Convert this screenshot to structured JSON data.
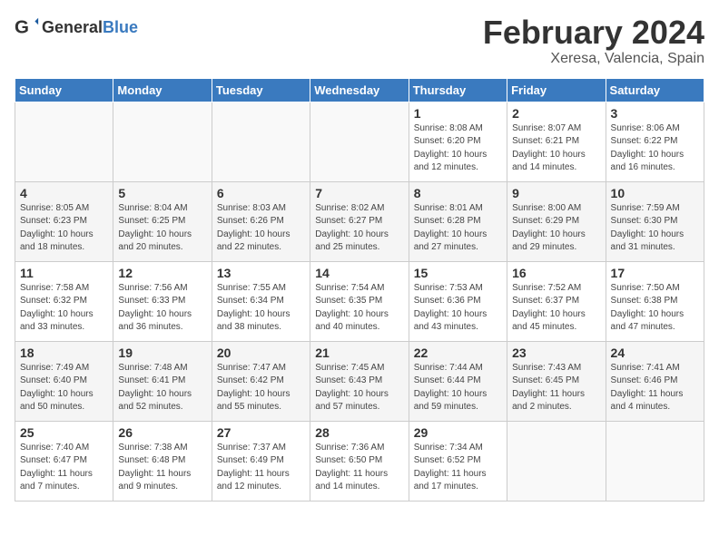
{
  "header": {
    "logo_general": "General",
    "logo_blue": "Blue",
    "title": "February 2024",
    "subtitle": "Xeresa, Valencia, Spain"
  },
  "weekdays": [
    "Sunday",
    "Monday",
    "Tuesday",
    "Wednesday",
    "Thursday",
    "Friday",
    "Saturday"
  ],
  "weeks": [
    [
      {
        "day": "",
        "empty": true
      },
      {
        "day": "",
        "empty": true
      },
      {
        "day": "",
        "empty": true
      },
      {
        "day": "",
        "empty": true
      },
      {
        "day": "1",
        "sunrise": "8:08 AM",
        "sunset": "6:20 PM",
        "daylight": "10 hours and 12 minutes."
      },
      {
        "day": "2",
        "sunrise": "8:07 AM",
        "sunset": "6:21 PM",
        "daylight": "10 hours and 14 minutes."
      },
      {
        "day": "3",
        "sunrise": "8:06 AM",
        "sunset": "6:22 PM",
        "daylight": "10 hours and 16 minutes."
      }
    ],
    [
      {
        "day": "4",
        "sunrise": "8:05 AM",
        "sunset": "6:23 PM",
        "daylight": "10 hours and 18 minutes."
      },
      {
        "day": "5",
        "sunrise": "8:04 AM",
        "sunset": "6:25 PM",
        "daylight": "10 hours and 20 minutes."
      },
      {
        "day": "6",
        "sunrise": "8:03 AM",
        "sunset": "6:26 PM",
        "daylight": "10 hours and 22 minutes."
      },
      {
        "day": "7",
        "sunrise": "8:02 AM",
        "sunset": "6:27 PM",
        "daylight": "10 hours and 25 minutes."
      },
      {
        "day": "8",
        "sunrise": "8:01 AM",
        "sunset": "6:28 PM",
        "daylight": "10 hours and 27 minutes."
      },
      {
        "day": "9",
        "sunrise": "8:00 AM",
        "sunset": "6:29 PM",
        "daylight": "10 hours and 29 minutes."
      },
      {
        "day": "10",
        "sunrise": "7:59 AM",
        "sunset": "6:30 PM",
        "daylight": "10 hours and 31 minutes."
      }
    ],
    [
      {
        "day": "11",
        "sunrise": "7:58 AM",
        "sunset": "6:32 PM",
        "daylight": "10 hours and 33 minutes."
      },
      {
        "day": "12",
        "sunrise": "7:56 AM",
        "sunset": "6:33 PM",
        "daylight": "10 hours and 36 minutes."
      },
      {
        "day": "13",
        "sunrise": "7:55 AM",
        "sunset": "6:34 PM",
        "daylight": "10 hours and 38 minutes."
      },
      {
        "day": "14",
        "sunrise": "7:54 AM",
        "sunset": "6:35 PM",
        "daylight": "10 hours and 40 minutes."
      },
      {
        "day": "15",
        "sunrise": "7:53 AM",
        "sunset": "6:36 PM",
        "daylight": "10 hours and 43 minutes."
      },
      {
        "day": "16",
        "sunrise": "7:52 AM",
        "sunset": "6:37 PM",
        "daylight": "10 hours and 45 minutes."
      },
      {
        "day": "17",
        "sunrise": "7:50 AM",
        "sunset": "6:38 PM",
        "daylight": "10 hours and 47 minutes."
      }
    ],
    [
      {
        "day": "18",
        "sunrise": "7:49 AM",
        "sunset": "6:40 PM",
        "daylight": "10 hours and 50 minutes."
      },
      {
        "day": "19",
        "sunrise": "7:48 AM",
        "sunset": "6:41 PM",
        "daylight": "10 hours and 52 minutes."
      },
      {
        "day": "20",
        "sunrise": "7:47 AM",
        "sunset": "6:42 PM",
        "daylight": "10 hours and 55 minutes."
      },
      {
        "day": "21",
        "sunrise": "7:45 AM",
        "sunset": "6:43 PM",
        "daylight": "10 hours and 57 minutes."
      },
      {
        "day": "22",
        "sunrise": "7:44 AM",
        "sunset": "6:44 PM",
        "daylight": "10 hours and 59 minutes."
      },
      {
        "day": "23",
        "sunrise": "7:43 AM",
        "sunset": "6:45 PM",
        "daylight": "11 hours and 2 minutes."
      },
      {
        "day": "24",
        "sunrise": "7:41 AM",
        "sunset": "6:46 PM",
        "daylight": "11 hours and 4 minutes."
      }
    ],
    [
      {
        "day": "25",
        "sunrise": "7:40 AM",
        "sunset": "6:47 PM",
        "daylight": "11 hours and 7 minutes."
      },
      {
        "day": "26",
        "sunrise": "7:38 AM",
        "sunset": "6:48 PM",
        "daylight": "11 hours and 9 minutes."
      },
      {
        "day": "27",
        "sunrise": "7:37 AM",
        "sunset": "6:49 PM",
        "daylight": "11 hours and 12 minutes."
      },
      {
        "day": "28",
        "sunrise": "7:36 AM",
        "sunset": "6:50 PM",
        "daylight": "11 hours and 14 minutes."
      },
      {
        "day": "29",
        "sunrise": "7:34 AM",
        "sunset": "6:52 PM",
        "daylight": "11 hours and 17 minutes."
      },
      {
        "day": "",
        "empty": true
      },
      {
        "day": "",
        "empty": true
      }
    ]
  ]
}
